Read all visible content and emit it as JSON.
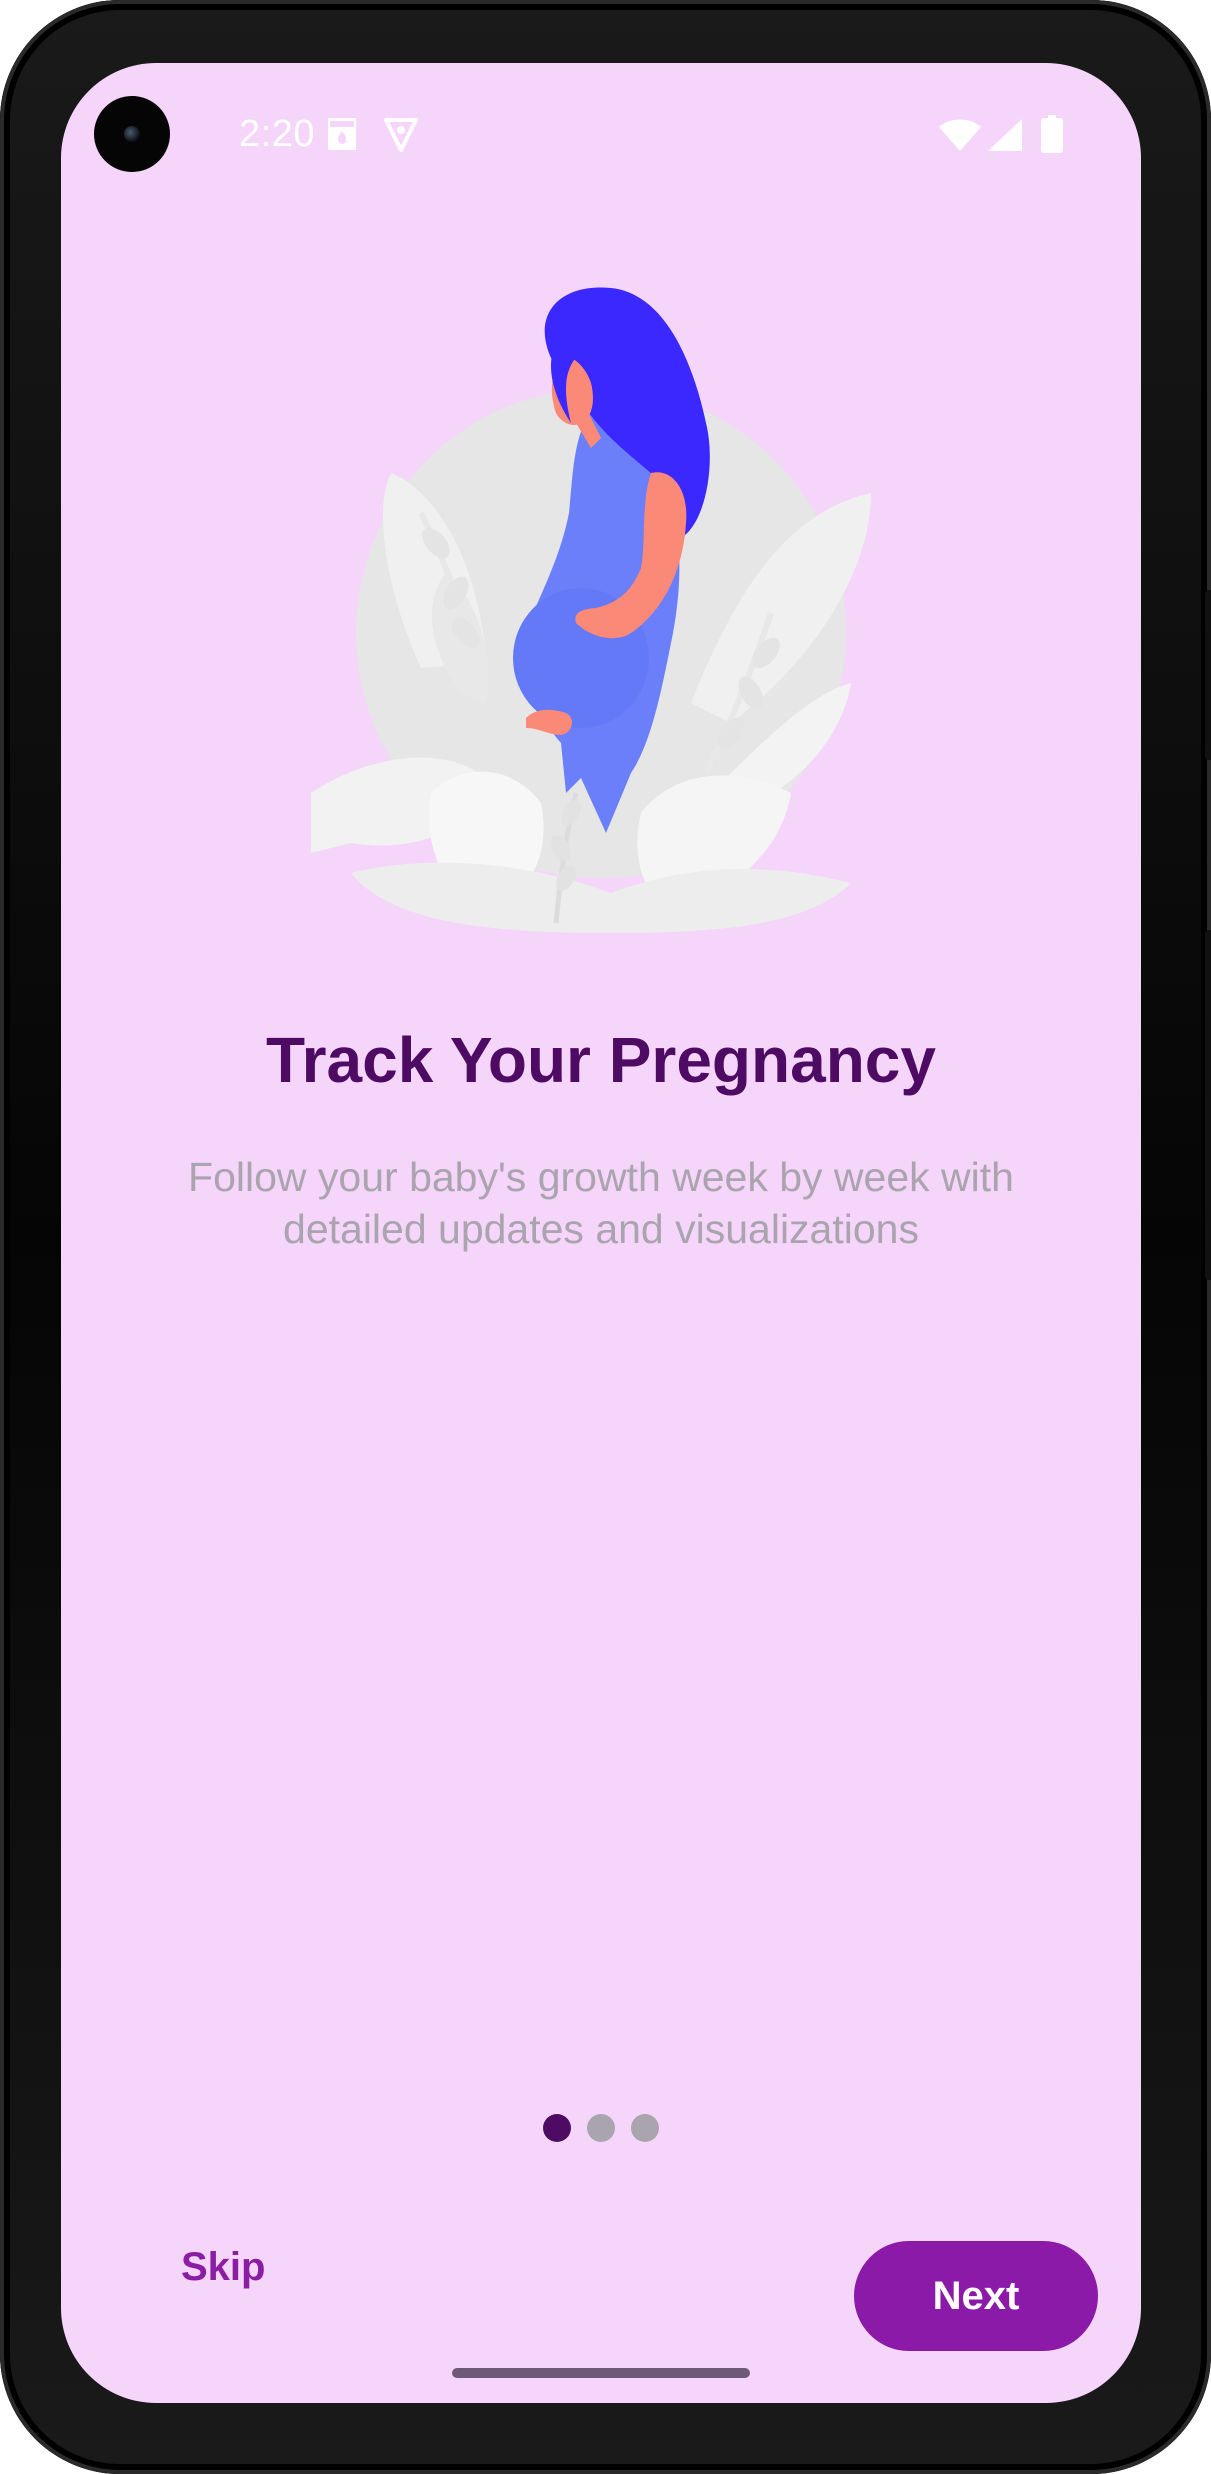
{
  "status_bar": {
    "time": "2:20",
    "notification_icons": [
      "sim-card-icon",
      "shield-icon"
    ],
    "system_icons": [
      "wifi-icon",
      "cell-signal-icon",
      "battery-icon"
    ]
  },
  "onboarding": {
    "illustration": "pregnant-woman-illustration",
    "title": "Track Your Pregnancy",
    "subtitle": "Follow your baby's growth week by week with detailed updates and visualizations",
    "page_indicator": {
      "total": 3,
      "current": 1
    },
    "skip_label": "Skip",
    "next_label": "Next"
  },
  "colors": {
    "background": "#f5d5fa",
    "title": "#4e0b63",
    "subtitle": "#a9a4ad",
    "accent": "#8b1aa8",
    "dot_inactive": "#a9a4ad",
    "dot_active": "#4e0b63"
  }
}
